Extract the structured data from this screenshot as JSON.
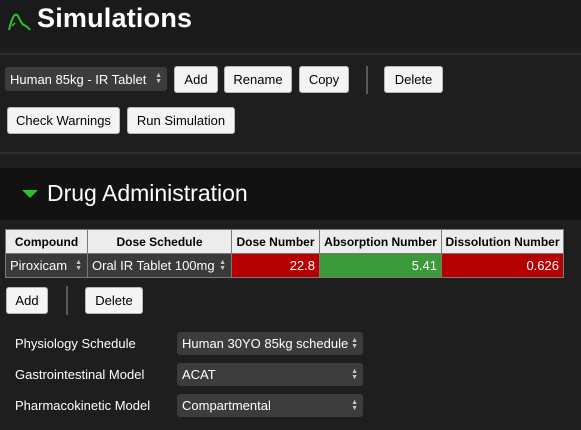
{
  "header": {
    "title": "Simulations",
    "logo_icon": "curve-logo-icon",
    "accent_color": "#2ec12e"
  },
  "toolbar": {
    "simulation_select": "Human 85kg - IR Tablet",
    "add_label": "Add",
    "rename_label": "Rename",
    "copy_label": "Copy",
    "delete_label": "Delete",
    "check_warnings_label": "Check Warnings",
    "run_simulation_label": "Run Simulation"
  },
  "drug_administration": {
    "title": "Drug Administration",
    "columns": [
      "Compound",
      "Dose Schedule",
      "Dose Number",
      "Absorption Number",
      "Dissolution Number"
    ],
    "rows": [
      {
        "compound": "Piroxicam",
        "dose_schedule": "Oral IR Tablet 100mg",
        "dose_number": "22.8",
        "absorption_number": "5.41",
        "dissolution_number": "0.626"
      }
    ],
    "status_colors": {
      "dose_number": "#b40000",
      "absorption_number": "#3a9a3a",
      "dissolution_number": "#b40000"
    },
    "add_label": "Add",
    "delete_label": "Delete"
  },
  "settings": {
    "physiology_label": "Physiology Schedule",
    "physiology_value": "Human 30YO 85kg schedule",
    "gi_label": "Gastrointestinal Model",
    "gi_value": "ACAT",
    "pk_label": "Pharmacokinetic Model",
    "pk_value": "Compartmental"
  }
}
